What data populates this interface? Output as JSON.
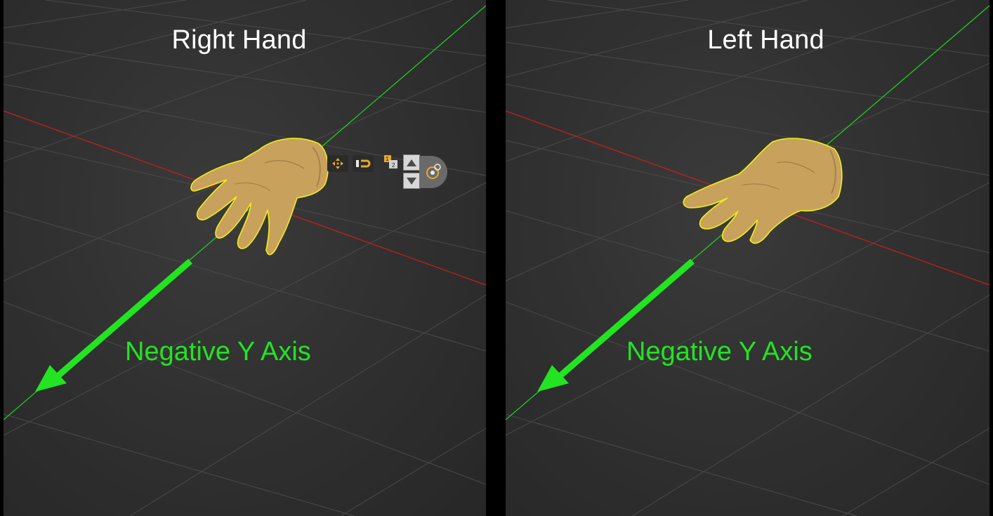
{
  "panels": {
    "left": {
      "title": "Right Hand",
      "axis_label": "Negative Y Axis"
    },
    "right": {
      "title": "Left Hand",
      "axis_label": "Negative Y Axis"
    }
  },
  "colors": {
    "axis_label": "#22e422",
    "y_axis": "#1fd61f",
    "x_axis": "#d21b1b",
    "selection_outline": "#f2ee19",
    "hand": "#c8a25c"
  },
  "gizmo": {
    "icons": [
      "move-icon",
      "snap-icon",
      "layer-swap-icon",
      "arrow-up-icon",
      "arrow-down-icon",
      "camera-orbit-icon"
    ]
  }
}
